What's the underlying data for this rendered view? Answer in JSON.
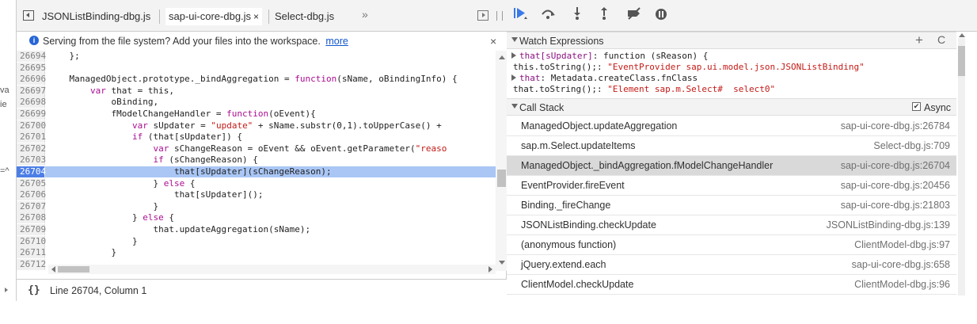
{
  "edge_labels": [
    "va",
    "ie",
    "=^"
  ],
  "tabs": [
    {
      "label": "JSONListBinding-dbg.js",
      "active": false
    },
    {
      "label": "sap-ui-core-dbg.js",
      "active": true,
      "close": "×"
    },
    {
      "label": "Select-dbg.js",
      "active": false
    }
  ],
  "tab_overflow": "»",
  "infobar": {
    "text": "Serving from the file system? Add your files into the workspace.",
    "link": "more",
    "close": "×",
    "icon": "info-icon"
  },
  "editor": {
    "lines": [
      {
        "num": "26694",
        "code": "    };"
      },
      {
        "num": "26695",
        "code": ""
      },
      {
        "num": "26696",
        "code": "    ManagedObject.prototype._bindAggregation = function(sName, oBindingInfo) {"
      },
      {
        "num": "26697",
        "code": "        var that = this,"
      },
      {
        "num": "26698",
        "code": "            oBinding,"
      },
      {
        "num": "26699",
        "code": "            fModelChangeHandler = function(oEvent){"
      },
      {
        "num": "26700",
        "code": "                var sUpdater = \"update\" + sName.substr(0,1).toUpperCase() +"
      },
      {
        "num": "26701",
        "code": "                if (that[sUpdater]) {"
      },
      {
        "num": "26702",
        "code": "                    var sChangeReason = oEvent && oEvent.getParameter(\"reaso"
      },
      {
        "num": "26703",
        "code": "                    if (sChangeReason) {"
      },
      {
        "num": "26704",
        "code": "                        that[sUpdater](sChangeReason);",
        "exec": true
      },
      {
        "num": "26705",
        "code": "                    } else {"
      },
      {
        "num": "26706",
        "code": "                        that[sUpdater]();"
      },
      {
        "num": "26707",
        "code": "                    }"
      },
      {
        "num": "26708",
        "code": "                } else {"
      },
      {
        "num": "26709",
        "code": "                    that.updateAggregation(sName);"
      },
      {
        "num": "26710",
        "code": "                }"
      },
      {
        "num": "26711",
        "code": "            }"
      },
      {
        "num": "26712",
        "code": ""
      }
    ]
  },
  "statusbar": {
    "pretty_print": "{}",
    "cursor": "Line 26704, Column 1"
  },
  "debugger": {
    "watch": {
      "title": "Watch Expressions",
      "add": "+",
      "refresh": "C",
      "rows": [
        {
          "arrow": true,
          "name": "that[sUpdater]",
          "value": ": function (sReason) {"
        },
        {
          "arrow": false,
          "name": "",
          "value": "this.toString();: ",
          "str": "\"EventProvider sap.ui.model.json.JSONListBinding\""
        },
        {
          "arrow": true,
          "name": "that",
          "value": ": Metadata.createClass.fnClass"
        },
        {
          "arrow": false,
          "name": "",
          "value": "that.toString();: ",
          "str": "\"Element sap.m.Select#  select0\""
        }
      ]
    },
    "callstack": {
      "title": "Call Stack",
      "async_label": "Async",
      "async_checked": true,
      "frames": [
        {
          "fn": "ManagedObject.updateAggregation",
          "loc": "sap-ui-core-dbg.js:26784"
        },
        {
          "fn": "sap.m.Select.updateItems",
          "loc": "Select-dbg.js:709"
        },
        {
          "fn": "ManagedObject._bindAggregation.fModelChangeHandler",
          "loc": "sap-ui-core-dbg.js:26704",
          "selected": true
        },
        {
          "fn": "EventProvider.fireEvent",
          "loc": "sap-ui-core-dbg.js:20456"
        },
        {
          "fn": "Binding._fireChange",
          "loc": "sap-ui-core-dbg.js:21803"
        },
        {
          "fn": "JSONListBinding.checkUpdate",
          "loc": "JSONListBinding-dbg.js:139"
        },
        {
          "fn": "(anonymous function)",
          "loc": "ClientModel-dbg.js:97"
        },
        {
          "fn": "jQuery.extend.each",
          "loc": "sap-ui-core-dbg.js:658"
        },
        {
          "fn": "ClientModel.checkUpdate",
          "loc": "ClientModel-dbg.js:96"
        }
      ]
    }
  },
  "colors": {
    "exec_line": "#a9c6f5",
    "exec_gutter": "#4c7ee6",
    "selected_frame": "#d9d9d9",
    "resume_icon": "#3a79e8"
  }
}
